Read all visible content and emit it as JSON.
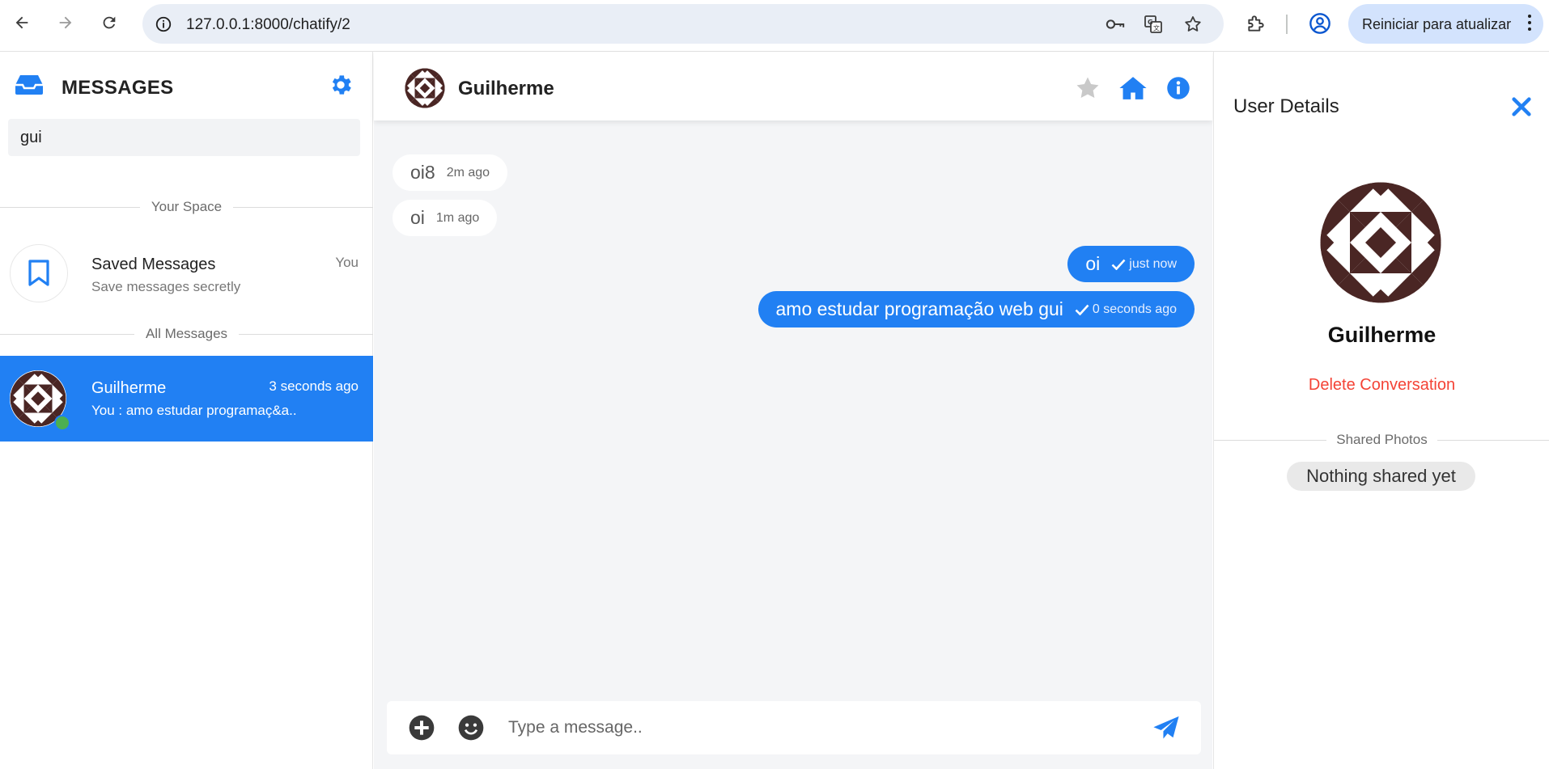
{
  "browser": {
    "url": "127.0.0.1:8000/chatify/2",
    "update_button": "Reiniciar para atualizar"
  },
  "sidebar": {
    "title": "MESSAGES",
    "search_value": "gui",
    "your_space_label": "Your Space",
    "saved": {
      "name": "Saved Messages",
      "subtitle": "Save messages secretly",
      "meta": "You"
    },
    "all_messages_label": "All Messages",
    "contacts": [
      {
        "name": "Guilherme",
        "last_message": "You : amo estudar programaç&a..",
        "time": "3 seconds ago",
        "online": true
      }
    ]
  },
  "chat": {
    "contact_name": "Guilherme",
    "messages": [
      {
        "direction": "in",
        "text": "oi8",
        "time": "2m ago"
      },
      {
        "direction": "in",
        "text": "oi",
        "time": "1m ago"
      },
      {
        "direction": "out",
        "text": "oi",
        "time": "just now",
        "seen": true
      },
      {
        "direction": "out",
        "text": "amo estudar programação web gui",
        "time": "0 seconds ago",
        "seen": true
      }
    ],
    "composer_placeholder": "Type a message.."
  },
  "info": {
    "title": "User Details",
    "name": "Guilherme",
    "delete_label": "Delete Conversation",
    "shared_photos_label": "Shared Photos",
    "shared_empty": "Nothing shared yet"
  },
  "colors": {
    "accent": "#2180f3",
    "online": "#4caf50",
    "danger": "#f44336",
    "avatar_pattern": "#4a2624"
  },
  "icons": [
    "back-arrow-icon",
    "forward-arrow-icon",
    "reload-icon",
    "site-info-icon",
    "key-icon",
    "translate-icon",
    "star-icon",
    "extensions-icon",
    "profile-icon",
    "inbox-icon",
    "gear-icon",
    "bookmark-icon",
    "favorite-star-icon",
    "home-icon",
    "info-icon",
    "plus-icon",
    "emoji-icon",
    "send-icon",
    "close-icon",
    "check-icon"
  ]
}
